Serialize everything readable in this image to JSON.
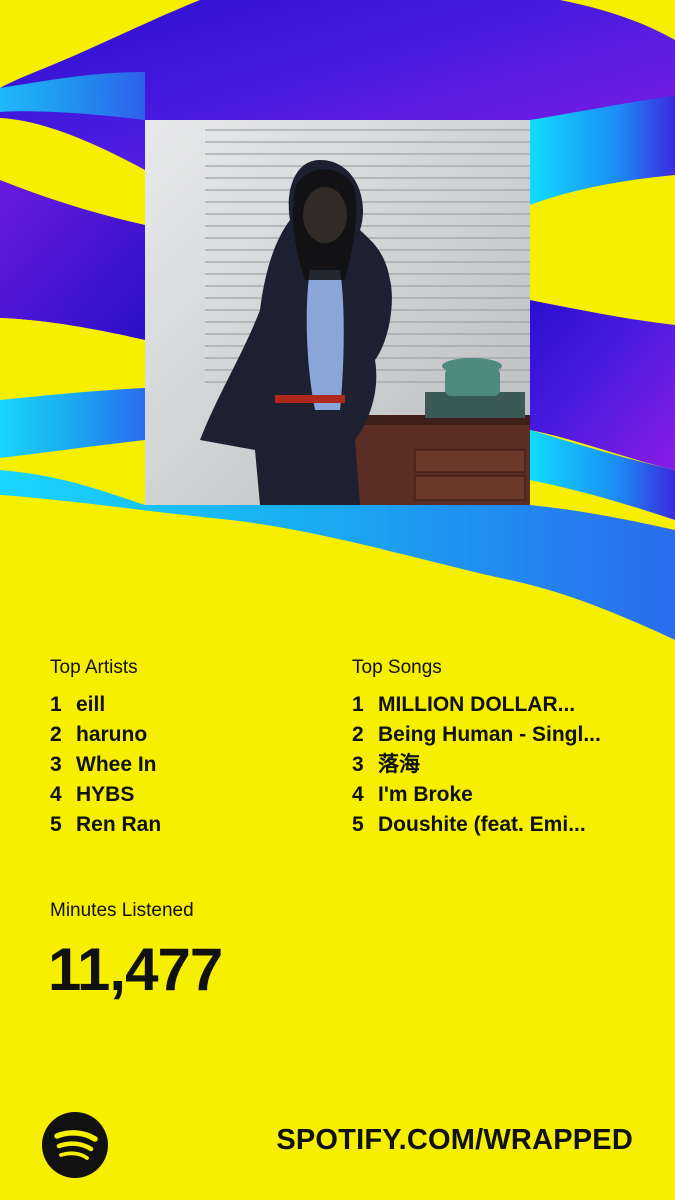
{
  "colors": {
    "background": "#f6ef00",
    "purple": "#3b16d6",
    "violet": "#7a1de0",
    "cyan": "#1ec8f2",
    "text": "#111111"
  },
  "cover": {
    "icon": "album-cover-image"
  },
  "top_artists": {
    "label": "Top Artists",
    "items": [
      {
        "rank": "1",
        "name": "eill"
      },
      {
        "rank": "2",
        "name": "haruno"
      },
      {
        "rank": "3",
        "name": "Whee In"
      },
      {
        "rank": "4",
        "name": "HYBS"
      },
      {
        "rank": "5",
        "name": "Ren Ran"
      }
    ]
  },
  "top_songs": {
    "label": "Top Songs",
    "items": [
      {
        "rank": "1",
        "name": "MILLION DOLLAR..."
      },
      {
        "rank": "2",
        "name": "Being Human - Singl..."
      },
      {
        "rank": "3",
        "name": "落海"
      },
      {
        "rank": "4",
        "name": "I'm Broke"
      },
      {
        "rank": "5",
        "name": "Doushite (feat. Emi..."
      }
    ]
  },
  "minutes": {
    "label": "Minutes Listened",
    "value": "11,477"
  },
  "footer": {
    "logo_icon": "spotify-logo-icon",
    "url": "SPOTIFY.COM/WRAPPED"
  }
}
